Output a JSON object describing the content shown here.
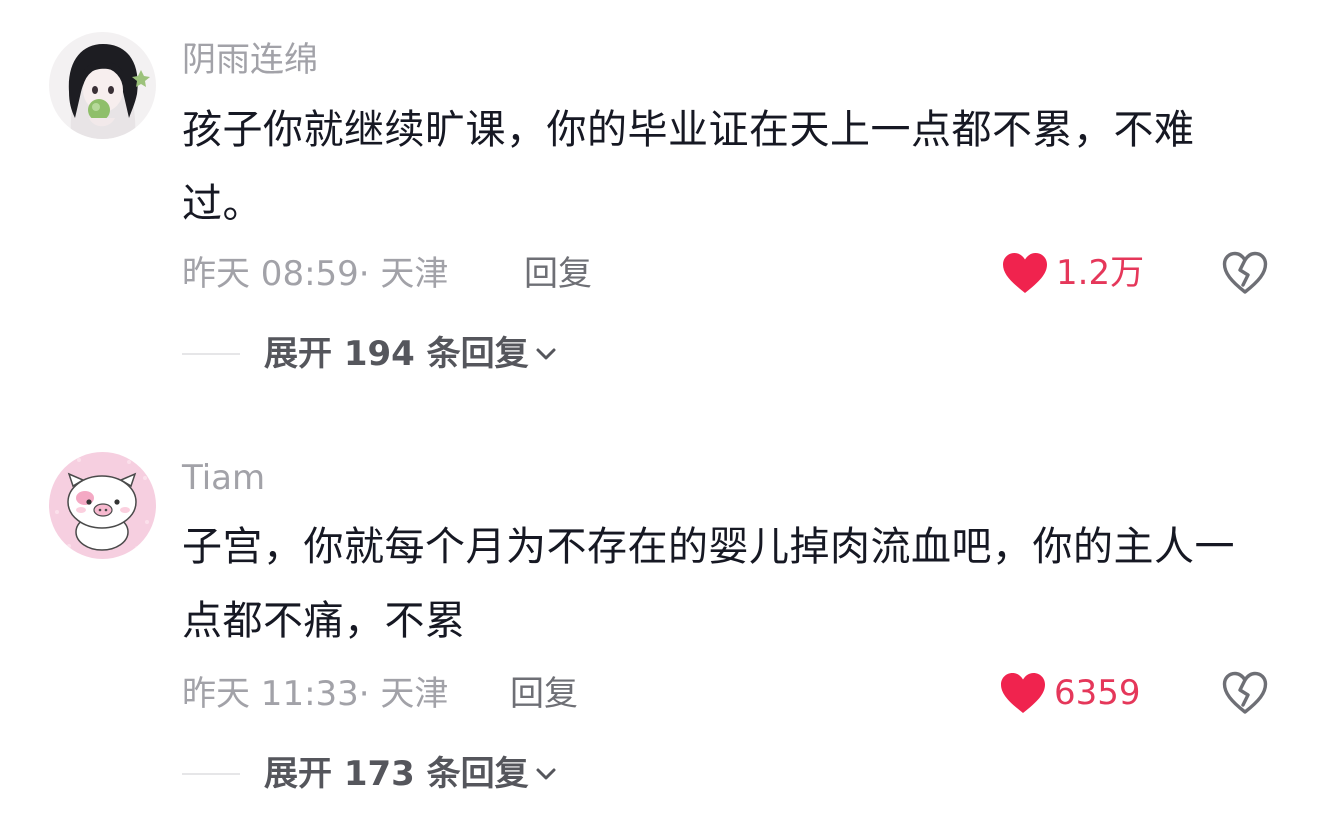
{
  "comments": [
    {
      "username": "阴雨连绵",
      "text": "孩子你就继续旷课，你的毕业证在天上一点都不累，不难过。",
      "meta": "昨天 08:59· 天津",
      "reply_label": "回复",
      "likes": "1.2万",
      "expand_label": "展开 194 条回复",
      "avatar_icon": "girl-avatar"
    },
    {
      "username": "Tiam",
      "text": "子宫，你就每个月为不存在的婴儿掉肉流血吧，你的主人一点都不痛，不累",
      "meta": "昨天 11:33· 天津",
      "reply_label": "回复",
      "likes": "6359",
      "expand_label": "展开 173 条回复",
      "avatar_icon": "pig-avatar"
    }
  ],
  "colors": {
    "like": "#e5375a",
    "muted_text": "#a2a2a8",
    "body_text": "#161823"
  }
}
